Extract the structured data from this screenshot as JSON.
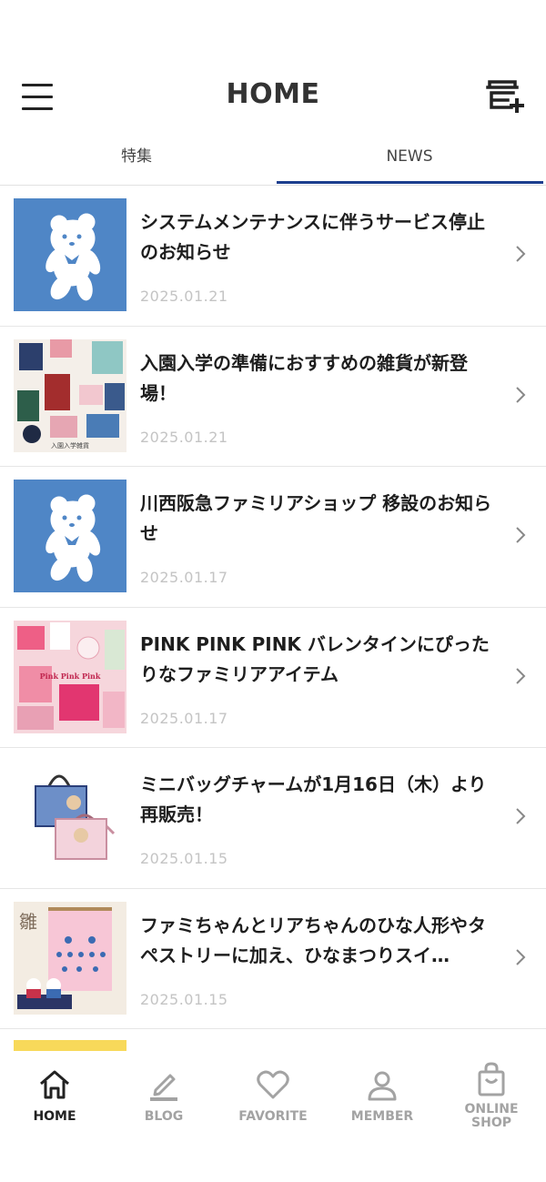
{
  "header": {
    "title": "HOME",
    "menu_icon": "hamburger-menu-icon",
    "shop_icon": "shop-add-icon"
  },
  "tabs": [
    {
      "label": "特集",
      "active": false
    },
    {
      "label": "NEWS",
      "active": true
    }
  ],
  "accent_color": "#1c3e8e",
  "news": [
    {
      "title": "システムメンテナンスに伴うサービス停止のお知らせ",
      "date": "2025.01.21",
      "thumb": "bear-logo"
    },
    {
      "title": "入園入学の準備におすすめの雑貨が新登場！",
      "date": "2025.01.21",
      "thumb": "school-goods-photo",
      "thumb_caption": "入園入学雑貨"
    },
    {
      "title": "川西阪急ファミリアショップ 移設のお知らせ",
      "date": "2025.01.17",
      "thumb": "bear-logo"
    },
    {
      "title": "PINK PINK PINK バレンタインにぴったりなファミリアアイテム",
      "date": "2025.01.17",
      "thumb": "pink-items-photo",
      "thumb_caption": "Pink Pink Pink"
    },
    {
      "title": "ミニバッグチャームが1月16日（木）より再販売！",
      "date": "2025.01.15",
      "thumb": "mini-bag-photo"
    },
    {
      "title": "ファミちゃんとリアちゃんのひな人形やタペストリーに加え、ひなまつりスイ…",
      "date": "2025.01.15",
      "thumb": "hina-doll-photo",
      "thumb_caption": "雛"
    }
  ],
  "bottom_nav": [
    {
      "label": "HOME",
      "icon": "home-icon",
      "active": true
    },
    {
      "label": "BLOG",
      "icon": "pencil-icon",
      "active": false
    },
    {
      "label": "FAVORITE",
      "icon": "heart-icon",
      "active": false
    },
    {
      "label": "MEMBER",
      "icon": "person-icon",
      "active": false
    },
    {
      "label_line1": "ONLINE",
      "label_line2": "SHOP",
      "icon": "shopping-bag-icon",
      "active": false
    }
  ]
}
